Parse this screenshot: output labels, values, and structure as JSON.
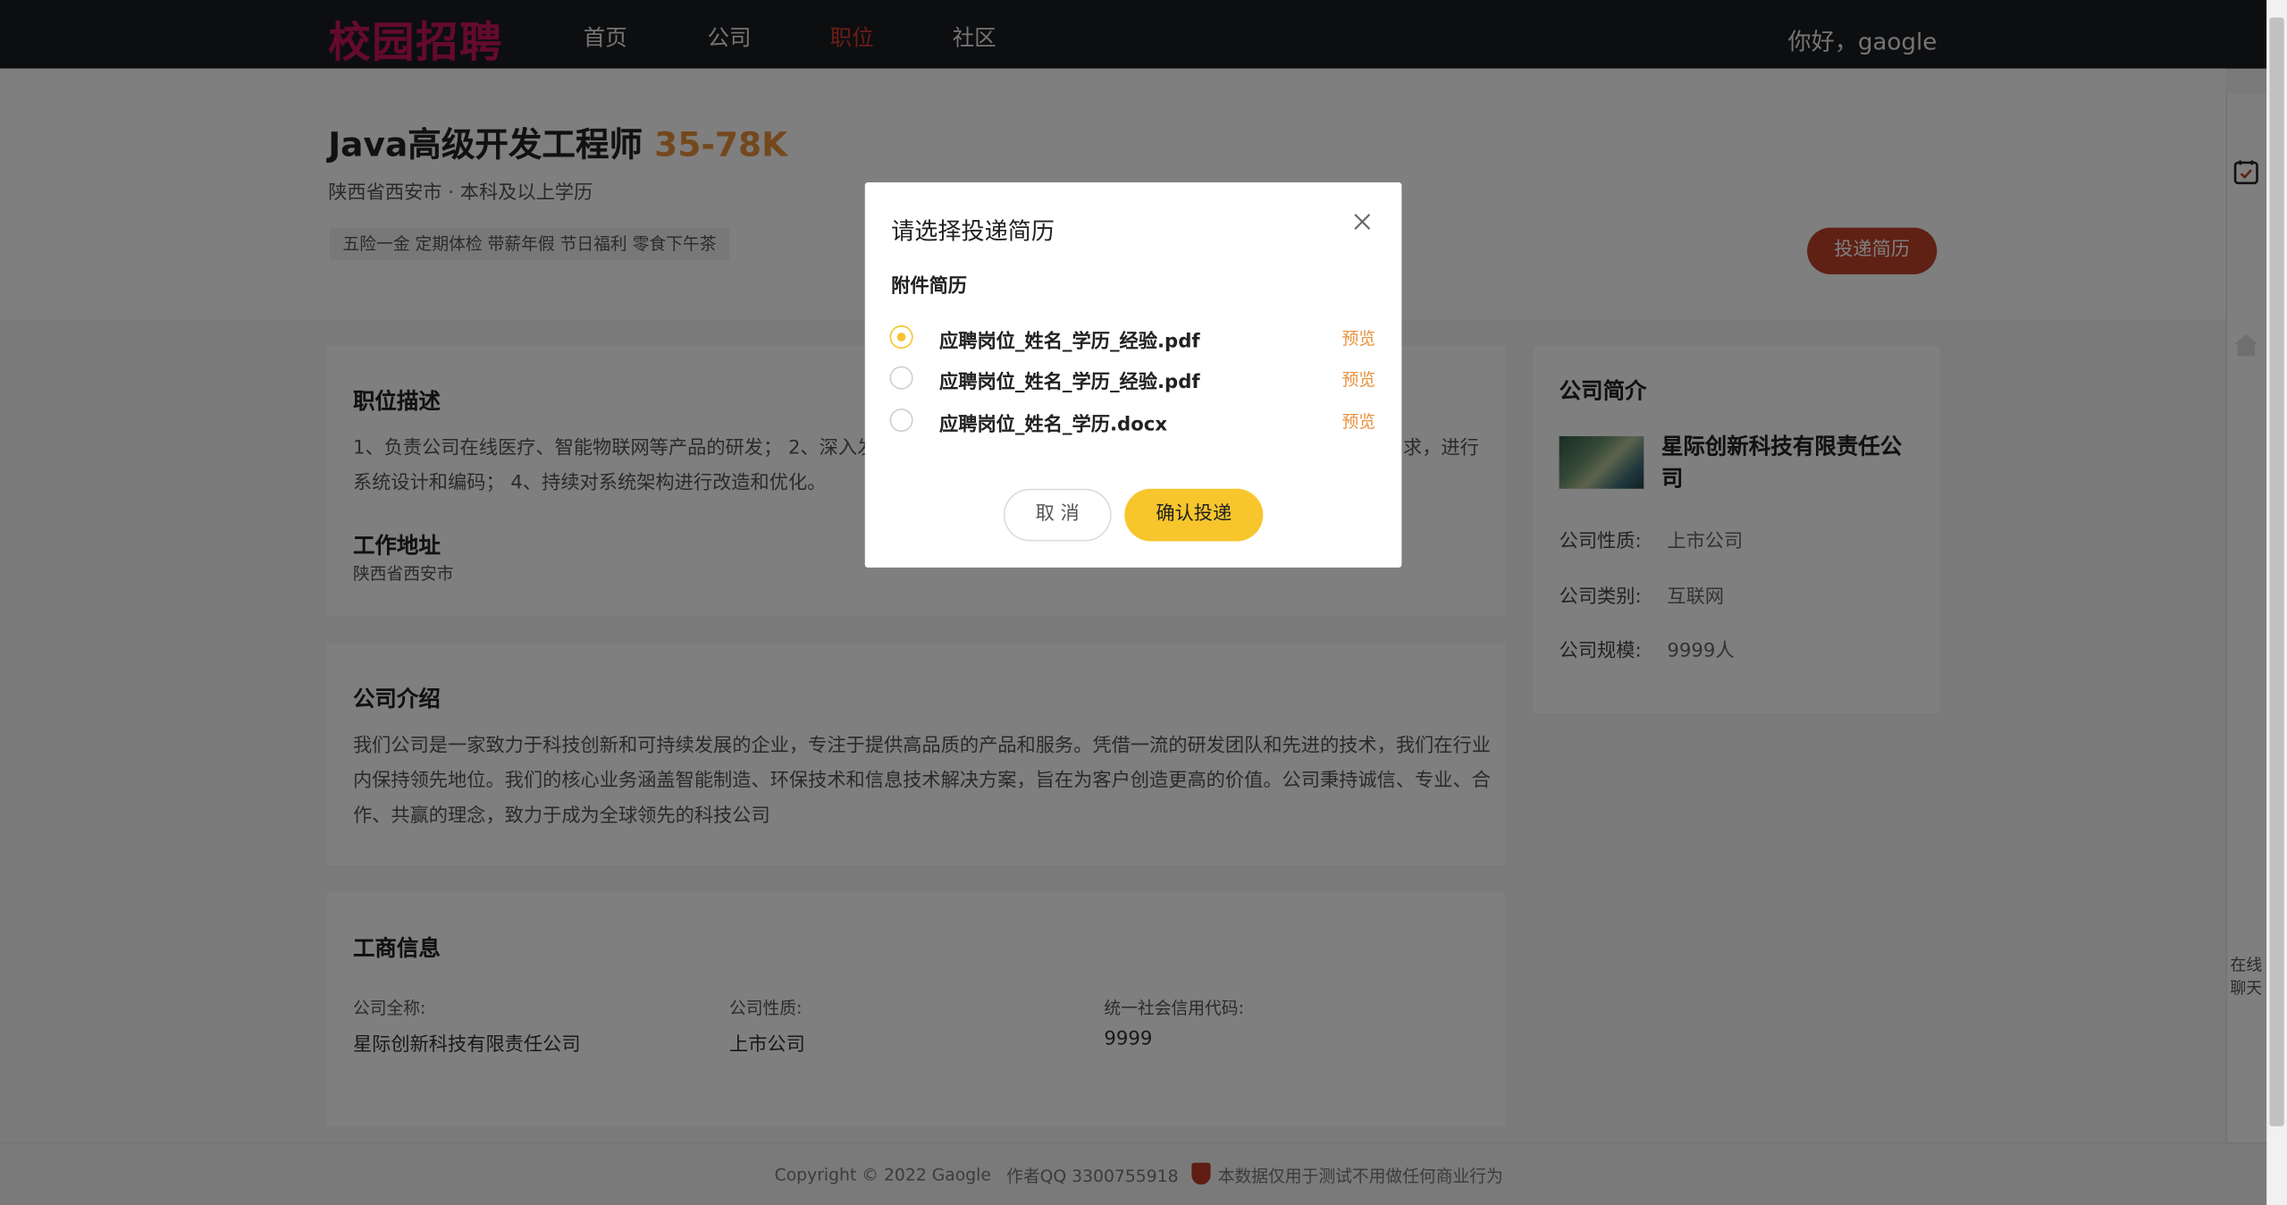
{
  "nav": {
    "logo": "校园招聘",
    "links": [
      "首页",
      "公司",
      "职位",
      "社区"
    ],
    "active": "职位",
    "greeting": "你好，gaogle"
  },
  "job": {
    "title": "Java高级开发工程师",
    "salary": "35-78K",
    "meta": "陕西省西安市 · 本科及以上学历",
    "tags": "五险一金 定期体检 带薪年假 节日福利 零食下午茶",
    "apply_label": "投递简历"
  },
  "description": {
    "title": "职位描述",
    "line1": "1、负责公司在线医疗、智能物联网等产品的研发； 2、深入发",
    "line1_tail": "求，进行",
    "line2": "系统设计和编码； 4、持续对系统架构进行改造和优化。",
    "address_title": "工作地址",
    "address": "陕西省西安市"
  },
  "company_intro": {
    "title": "公司介绍",
    "line1": "我们公司是一家致力于科技创新和可持续发展的企业，专注于提供高品质的产品和服务。凭借一流的研发团队和先进的技术，我们在行业",
    "line2": "内保持领先地位。我们的核心业务涵盖智能制造、环保技术和信息技术解决方案，旨在为客户创造更高的价值。公司秉持诚信、专业、合",
    "line3": "作、共赢的理念，致力于成为全球领先的科技公司"
  },
  "business": {
    "title": "工商信息",
    "full_name_label": "公司全称:",
    "full_name": "星际创新科技有限责任公司",
    "nature_label": "公司性质:",
    "nature": "上市公司",
    "credit_label": "统一社会信用代码:",
    "credit": "9999"
  },
  "company_card": {
    "title": "公司简介",
    "name": "星际创新科技有限责任公司",
    "nature_label": "公司性质:",
    "nature": "上市公司",
    "category_label": "公司类别:",
    "category": "互联网",
    "scale_label": "公司规模:",
    "scale": "9999人"
  },
  "rail": {
    "chat_label": "在线聊天"
  },
  "footer": {
    "copyright": "Copyright © 2022 Gaogle",
    "qq": "作者QQ 3300755918",
    "notice": "本数据仅用于测试不用做任何商业行为"
  },
  "modal": {
    "title": "请选择投递简历",
    "section": "附件简历",
    "files": [
      {
        "name": "应聘岗位_姓名_学历_经验.pdf",
        "preview": "预览",
        "selected": true
      },
      {
        "name": "应聘岗位_姓名_学历_经验.pdf",
        "preview": "预览",
        "selected": false
      },
      {
        "name": "应聘岗位_姓名_学历.docx",
        "preview": "预览",
        "selected": false
      }
    ],
    "cancel": "取 消",
    "confirm": "确认投递"
  },
  "colors": {
    "logo": "#c8155a",
    "accent": "#f7c62d",
    "salary": "#e8913c",
    "apply": "#c0432a",
    "nav_active": "#d93a2f"
  },
  "icons": [
    "resume-icon",
    "home-icon",
    "close-icon",
    "shield-icon"
  ]
}
